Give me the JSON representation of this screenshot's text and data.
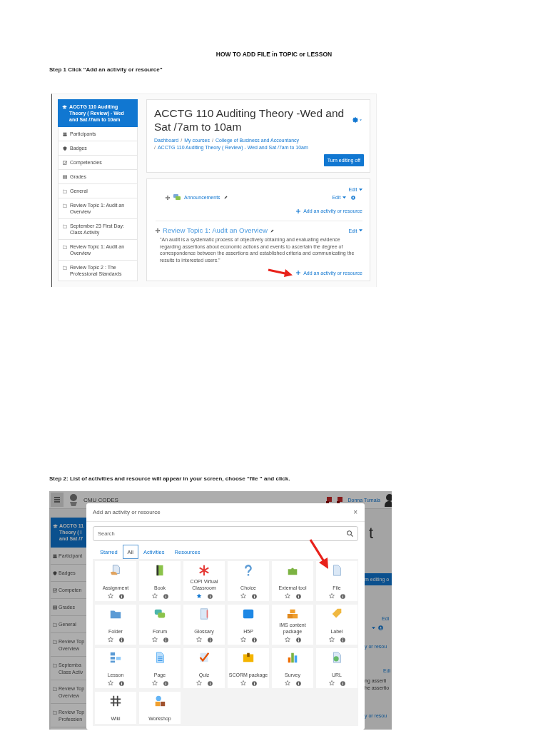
{
  "title": "HOW TO ADD FILE in TOPIC or LESSON",
  "step_1": {
    "text": "Step 1 Click “Add an activity or resource”",
    "screenshot": {
      "sidebar": {
        "header": "ACCTG 110 Auditing Theory ( Review) - Wed and Sat /7am to 10am",
        "items": [
          {
            "kind": "participants",
            "label": "Participants"
          },
          {
            "kind": "badges",
            "label": "Badges"
          },
          {
            "kind": "competencies",
            "label": "Competencies"
          },
          {
            "kind": "grades",
            "label": "Grades"
          },
          {
            "kind": "section",
            "label": "General"
          },
          {
            "kind": "section",
            "label": "Review Topic 1: Audit an Overview"
          },
          {
            "kind": "section",
            "label": "September 23 First Day: Class Activity"
          },
          {
            "kind": "section",
            "label": "Review Topic 1: Audit an Overview"
          },
          {
            "kind": "section",
            "label": "Review Topic 2 : The Professional Standards"
          }
        ]
      },
      "course_header": {
        "title": "ACCTG 110 Auditing Theory -Wed and Sat /7am to 10am",
        "separator": "/",
        "breadcrumbs": [
          "Dashboard",
          "My courses",
          "College of Business and Accountancy",
          "ACCTG 110 Auditing Theory ( Review) - Wed and Sat /7am to 10am"
        ],
        "button": "Turn editing off"
      },
      "general_section": {
        "edit": "Edit",
        "activity": {
          "name": "Announcements",
          "edit": "Edit"
        },
        "add_link": "Add an activity or resource"
      },
      "topic_section": {
        "title": "Review Topic 1: Audit an Overview",
        "edit": "Edit",
        "summary": "\"An audit is a systematic process of objectively obtaining and evaluating evidence regarding assertions about economic actions and events to ascertain the degree of correspondence between the assertions and established criteria and communicating the results to interested users.\"",
        "add_link": "Add an activity or resource"
      }
    }
  },
  "step_2": {
    "text": "Step 2: List of activities  and resource will appear in your screen, choose “file ” and click.",
    "screenshot": {
      "navbar": {
        "site": "CMU CODES",
        "user": "Donna Tumala"
      },
      "sidebar": {
        "header": [
          "ACCTG 11",
          "Theory ( I",
          "and Sat /7"
        ],
        "items": [
          {
            "kind": "participants",
            "lines": [
              "Participant"
            ]
          },
          {
            "kind": "badges",
            "lines": [
              "Badges"
            ]
          },
          {
            "kind": "competencies",
            "lines": [
              "Competen"
            ]
          },
          {
            "kind": "grades",
            "lines": [
              "Grades"
            ]
          },
          {
            "kind": "section",
            "lines": [
              "General"
            ]
          },
          {
            "kind": "section",
            "lines": [
              "Review Top",
              "Overview"
            ]
          },
          {
            "kind": "section",
            "lines": [
              "Septemba",
              "Class Activ"
            ]
          },
          {
            "kind": "section",
            "lines": [
              "Review Top",
              "Overview"
            ]
          },
          {
            "kind": "section",
            "lines": [
              "Review Top",
              "Professien"
            ]
          }
        ]
      },
      "right_column": [
        {
          "kind": "title",
          "text": "t"
        },
        {
          "kind": "button",
          "text": "m editing o"
        },
        {
          "kind": "link",
          "text": "Edi"
        },
        {
          "kind": "menu"
        },
        {
          "kind": "link",
          "text": "y or resou"
        },
        {
          "kind": "link",
          "text": "Edi"
        },
        {
          "kind": "text",
          "text": "ng asserti"
        },
        {
          "kind": "text",
          "text": "he assertio"
        },
        {
          "kind": "link",
          "text": "y or resou"
        }
      ],
      "modal": {
        "title": "Add an activity or resource",
        "close": "×",
        "search": {
          "placeholder": "Search"
        },
        "tabs": [
          {
            "label": "Starred",
            "selected": false
          },
          {
            "label": "All",
            "selected": true
          },
          {
            "label": "Activities",
            "selected": false
          },
          {
            "label": "Resources",
            "selected": false
          }
        ],
        "items": [
          {
            "label": "Assignment",
            "starred": false
          },
          {
            "label": "Book",
            "starred": false
          },
          {
            "label": "COPI Virtual Classroom",
            "starred": true
          },
          {
            "label": "Choice",
            "starred": false
          },
          {
            "label": "External tool",
            "starred": false
          },
          {
            "label": "File",
            "starred": false
          },
          {
            "label": "Folder",
            "starred": false
          },
          {
            "label": "Forum",
            "starred": false
          },
          {
            "label": "Glossary",
            "starred": false
          },
          {
            "label": "H5P",
            "starred": false
          },
          {
            "label": "IMS content package",
            "starred": false
          },
          {
            "label": "Label",
            "starred": false
          },
          {
            "label": "Lesson",
            "starred": false
          },
          {
            "label": "Page",
            "starred": false
          },
          {
            "label": "Quiz",
            "starred": false
          },
          {
            "label": "SCORM package",
            "starred": false
          },
          {
            "label": "Survey",
            "starred": false
          },
          {
            "label": "URL",
            "starred": false
          },
          {
            "label": "Wiki"
          },
          {
            "label": "Workshop"
          }
        ]
      }
    }
  }
}
